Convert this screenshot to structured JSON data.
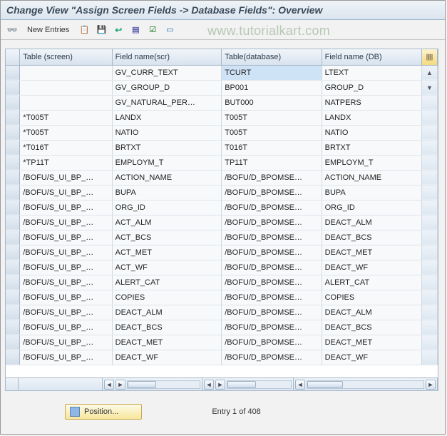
{
  "title": "Change View \"Assign Screen Fields -> Database Fields\": Overview",
  "watermark": "www.tutorialkart.com",
  "toolbar": {
    "new_entries": "New Entries"
  },
  "columns": {
    "c0": "Table (screen)",
    "c1": "Field name(scr)",
    "c2": "Table(database)",
    "c3": "Field name (DB)"
  },
  "rows": [
    {
      "c0": "",
      "c1": "GV_CURR_TEXT",
      "c2": "TCURT",
      "c3": "LTEXT",
      "sel": true
    },
    {
      "c0": "",
      "c1": "GV_GROUP_D",
      "c2": "BP001",
      "c3": "GROUP_D"
    },
    {
      "c0": "",
      "c1": "GV_NATURAL_PER…",
      "c2": "BUT000",
      "c3": "NATPERS"
    },
    {
      "c0": "*T005T",
      "c1": "LANDX",
      "c2": "T005T",
      "c3": "LANDX"
    },
    {
      "c0": "*T005T",
      "c1": "NATIO",
      "c2": "T005T",
      "c3": "NATIO"
    },
    {
      "c0": "*T016T",
      "c1": "BRTXT",
      "c2": "T016T",
      "c3": "BRTXT"
    },
    {
      "c0": "*TP11T",
      "c1": "EMPLOYM_T",
      "c2": "TP11T",
      "c3": "EMPLOYM_T"
    },
    {
      "c0": "/BOFU/S_UI_BP_…",
      "c1": "ACTION_NAME",
      "c2": "/BOFU/D_BPOMSE…",
      "c3": "ACTION_NAME"
    },
    {
      "c0": "/BOFU/S_UI_BP_…",
      "c1": "BUPA",
      "c2": "/BOFU/D_BPOMSE…",
      "c3": "BUPA"
    },
    {
      "c0": "/BOFU/S_UI_BP_…",
      "c1": "ORG_ID",
      "c2": "/BOFU/D_BPOMSE…",
      "c3": "ORG_ID"
    },
    {
      "c0": "/BOFU/S_UI_BP_…",
      "c1": "ACT_ALM",
      "c2": "/BOFU/D_BPOMSE…",
      "c3": "DEACT_ALM"
    },
    {
      "c0": "/BOFU/S_UI_BP_…",
      "c1": "ACT_BCS",
      "c2": "/BOFU/D_BPOMSE…",
      "c3": "DEACT_BCS"
    },
    {
      "c0": "/BOFU/S_UI_BP_…",
      "c1": "ACT_MET",
      "c2": "/BOFU/D_BPOMSE…",
      "c3": "DEACT_MET"
    },
    {
      "c0": "/BOFU/S_UI_BP_…",
      "c1": "ACT_WF",
      "c2": "/BOFU/D_BPOMSE…",
      "c3": "DEACT_WF"
    },
    {
      "c0": "/BOFU/S_UI_BP_…",
      "c1": "ALERT_CAT",
      "c2": "/BOFU/D_BPOMSE…",
      "c3": "ALERT_CAT"
    },
    {
      "c0": "/BOFU/S_UI_BP_…",
      "c1": "COPIES",
      "c2": "/BOFU/D_BPOMSE…",
      "c3": "COPIES"
    },
    {
      "c0": "/BOFU/S_UI_BP_…",
      "c1": "DEACT_ALM",
      "c2": "/BOFU/D_BPOMSE…",
      "c3": "DEACT_ALM"
    },
    {
      "c0": "/BOFU/S_UI_BP_…",
      "c1": "DEACT_BCS",
      "c2": "/BOFU/D_BPOMSE…",
      "c3": "DEACT_BCS"
    },
    {
      "c0": "/BOFU/S_UI_BP_…",
      "c1": "DEACT_MET",
      "c2": "/BOFU/D_BPOMSE…",
      "c3": "DEACT_MET"
    },
    {
      "c0": "/BOFU/S_UI_BP_…",
      "c1": "DEACT_WF",
      "c2": "/BOFU/D_BPOMSE…",
      "c3": "DEACT_WF"
    }
  ],
  "footer": {
    "position_label": "Position...",
    "entry_status": "Entry 1 of 408"
  }
}
